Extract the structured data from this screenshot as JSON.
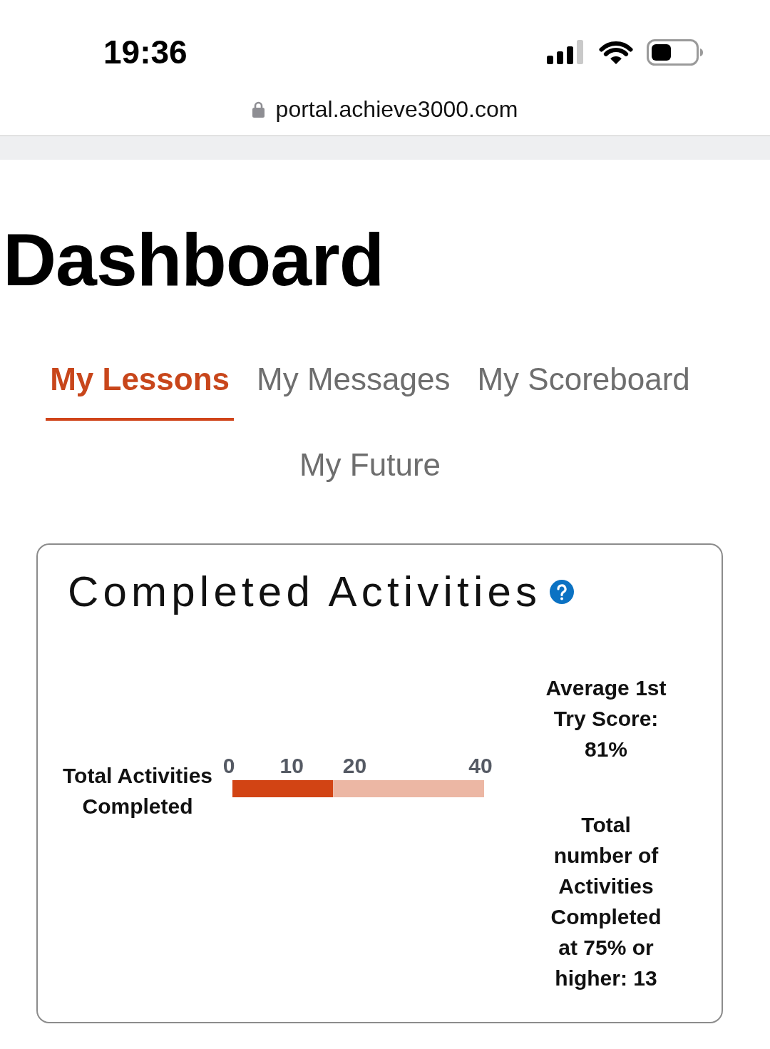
{
  "status_bar": {
    "time": "19:36"
  },
  "address_bar": {
    "url": "portal.achieve3000.com"
  },
  "page": {
    "title": "Dashboard"
  },
  "tabs": [
    {
      "label": "My Lessons",
      "selected": true
    },
    {
      "label": "My Messages",
      "selected": false
    },
    {
      "label": "My Scoreboard",
      "selected": false
    },
    {
      "label": "My Future",
      "selected": false
    }
  ],
  "card": {
    "title": "Completed Activities",
    "chart_data": {
      "type": "bar",
      "orientation": "horizontal",
      "stacked": true,
      "categories": [
        "Total Activities Completed"
      ],
      "series": [
        {
          "color": "#d24414",
          "values": [
            16
          ]
        },
        {
          "color": "#ecb7a4",
          "values": [
            24
          ]
        }
      ],
      "xlim": [
        0,
        40
      ],
      "xticks": [
        0,
        10,
        20,
        40
      ]
    },
    "stats": [
      "Average 1st Try Score: 81%",
      "Total number of Activities Completed at 75% or higher: 13"
    ]
  }
}
